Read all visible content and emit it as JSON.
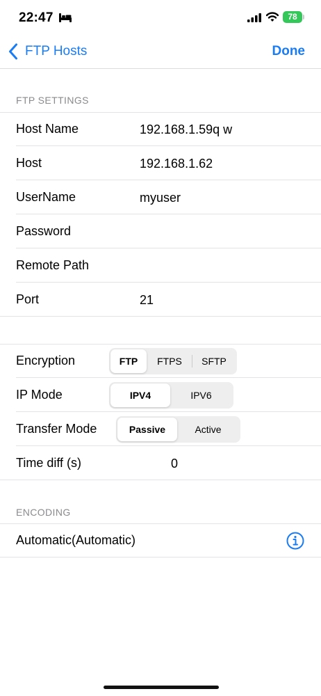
{
  "status_bar": {
    "time": "22:47",
    "battery": "78",
    "icons": [
      "bed-icon",
      "signal-icon",
      "wifi-icon",
      "battery-icon"
    ]
  },
  "nav": {
    "back_label": "FTP Hosts",
    "done_label": "Done"
  },
  "ftp_settings": {
    "header": "FTP SETTINGS",
    "rows": [
      {
        "label": "Host Name",
        "value": "192.168.1.59q w"
      },
      {
        "label": "Host",
        "value": "192.168.1.62"
      },
      {
        "label": "UserName",
        "value": "myuser"
      },
      {
        "label": "Password",
        "value": ""
      },
      {
        "label": "Remote Path",
        "value": ""
      },
      {
        "label": "Port",
        "value": "21"
      }
    ]
  },
  "connection": {
    "encryption": {
      "label": "Encryption",
      "options": [
        "FTP",
        "FTPS",
        "SFTP"
      ],
      "selected": "FTP"
    },
    "ip_mode": {
      "label": "IP Mode",
      "options": [
        "IPV4",
        "IPV6"
      ],
      "selected": "IPV4"
    },
    "transfer_mode": {
      "label": "Transfer Mode",
      "options": [
        "Passive",
        "Active"
      ],
      "selected": "Passive"
    },
    "time_diff": {
      "label": "Time diff (s)",
      "value": "0"
    }
  },
  "encoding": {
    "header": "ENCODING",
    "value": "Automatic(Automatic)",
    "icon": "info-icon"
  },
  "colors": {
    "accent": "#1a7cf5",
    "battery": "#34c759",
    "secondary_text": "#8a8a8e"
  }
}
